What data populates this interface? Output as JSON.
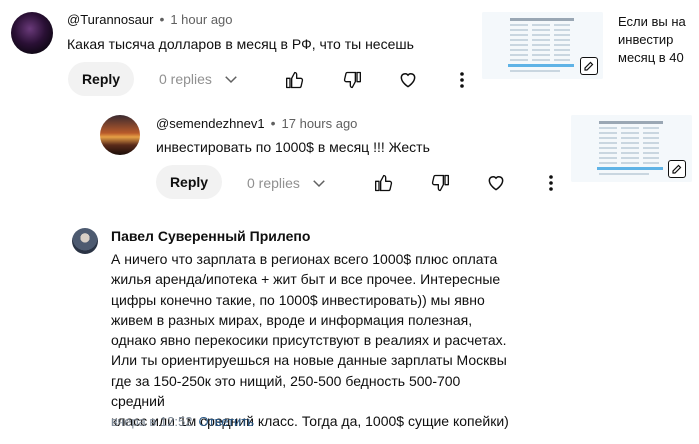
{
  "comment1": {
    "author": "@Turannosaur",
    "time": "1 hour ago",
    "text": "Какая тысяча долларов в месяц в РФ, что ты несешь",
    "reply_label": "Reply",
    "replies_label": "0 replies"
  },
  "comment2": {
    "author": "@semendezhnev1",
    "time": "17 hours ago",
    "text": "инвестировать по 1000$ в месяц !!! Жесть",
    "reply_label": "Reply",
    "replies_label": "0 replies"
  },
  "side": {
    "line1": "Если вы на",
    "line2": "инвестир",
    "line3": "месяц в 40"
  },
  "vk_comment": {
    "author": "Павел Суверенный Прилепо",
    "lines": [
      "А ничего что зарплата в регионах всего 1000$ плюс оплата",
      "жилья аренда/ипотека + жит быт и все прочее. Интересные",
      "цифры конечно такие, по 1000$ инвестировать)) мы явно",
      "живем в разных мирах, вроде и информация полезная,",
      "однако явно перекосики присутствуют в реалиях и расчетах.",
      "Или ты ориентируешься на новые данные зарплаты Москвы",
      "где за 150-250к это нищий, 250-500 бедность 500-700 средний",
      "класс или 1м средний класс. Тогда да, 1000$ сущие копейки)"
    ],
    "time": "вчера в 12:52",
    "reply_link": "Ответить"
  },
  "icons": {
    "like": "thumb-up-icon",
    "dislike": "thumb-down-icon",
    "heart": "heart-icon",
    "more": "more-vert-icon",
    "chevron": "chevron-down-icon",
    "edit": "edit-icon"
  }
}
